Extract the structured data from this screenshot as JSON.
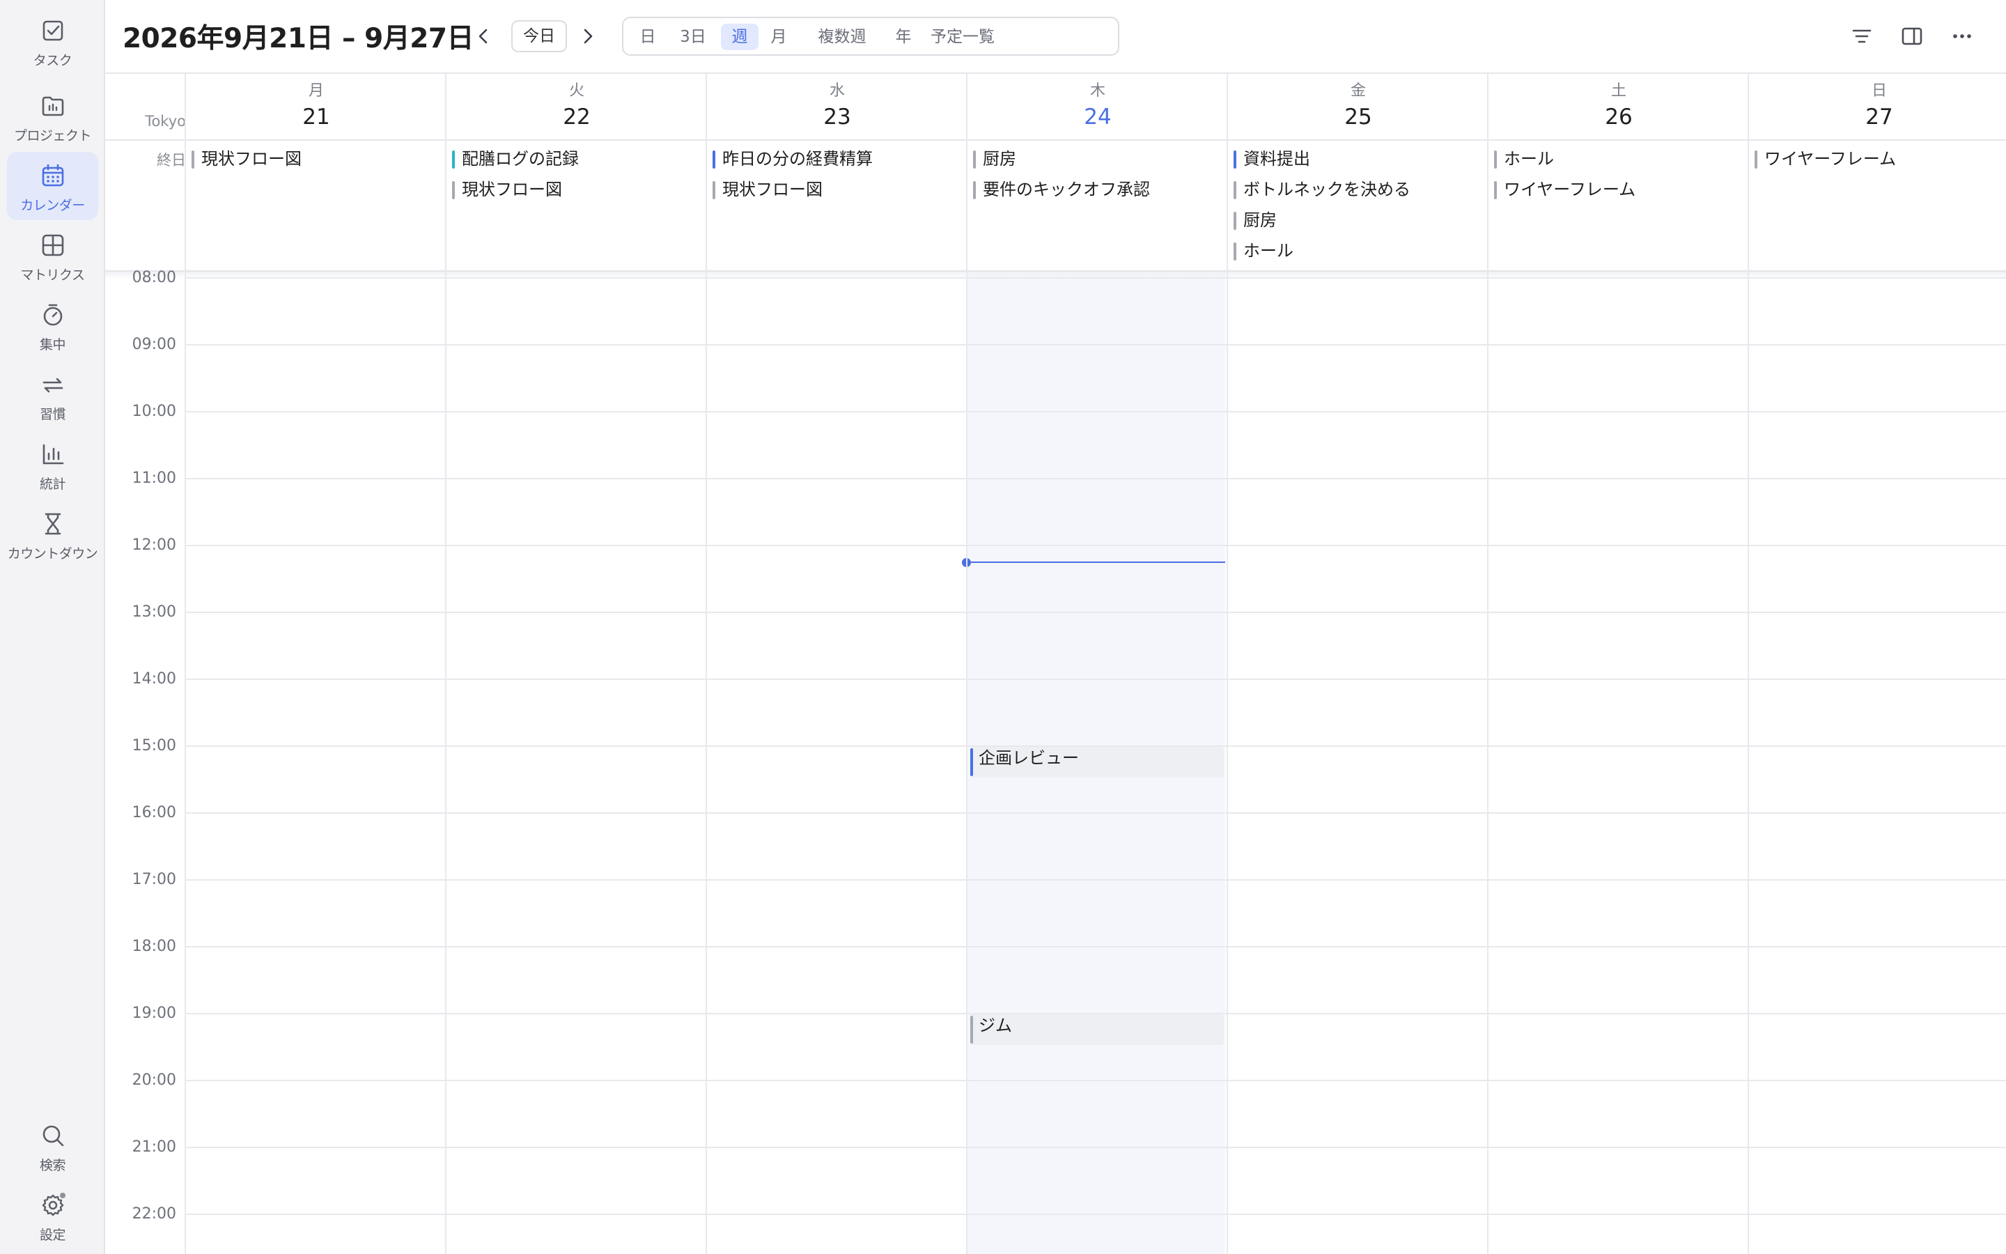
{
  "sidebar": {
    "items": [
      {
        "label": "タスク",
        "icon": "task-check-icon"
      },
      {
        "label": "プロジェクト",
        "icon": "project-folder-icon"
      },
      {
        "label": "カレンダー",
        "icon": "calendar-icon",
        "active": true
      },
      {
        "label": "マトリクス",
        "icon": "matrix-grid-icon"
      },
      {
        "label": "集中",
        "icon": "focus-timer-icon"
      },
      {
        "label": "習慣",
        "icon": "habit-repeat-icon"
      },
      {
        "label": "統計",
        "icon": "statistics-chart-icon"
      },
      {
        "label": "カウントダウン",
        "icon": "countdown-hourglass-icon"
      }
    ],
    "bottom": [
      {
        "label": "検索",
        "icon": "search-icon"
      },
      {
        "label": "設定",
        "icon": "settings-gear-icon"
      }
    ]
  },
  "header": {
    "title": "2026年9月21日 – 9月27日",
    "today_label": "今日",
    "views": [
      "日",
      "3日",
      "週",
      "月",
      "複数週",
      "年",
      "予定一覧"
    ],
    "active_view": "週"
  },
  "calendar": {
    "timezone": "Tokyo",
    "allday_label": "終日",
    "days": [
      {
        "dow": "月",
        "date": "21"
      },
      {
        "dow": "火",
        "date": "22"
      },
      {
        "dow": "水",
        "date": "23"
      },
      {
        "dow": "木",
        "date": "24",
        "today": true
      },
      {
        "dow": "金",
        "date": "25"
      },
      {
        "dow": "土",
        "date": "26"
      },
      {
        "dow": "日",
        "date": "27"
      }
    ],
    "allday_events": [
      [
        {
          "title": "現状フロー図",
          "color": "#a7a9b0"
        }
      ],
      [
        {
          "title": "配膳ログの記録",
          "color": "#2bb3c0"
        },
        {
          "title": "現状フロー図",
          "color": "#a7a9b0"
        }
      ],
      [
        {
          "title": "昨日の分の経費精算",
          "color": "#4b6fe2"
        },
        {
          "title": "現状フロー図",
          "color": "#a7a9b0"
        }
      ],
      [
        {
          "title": "厨房",
          "color": "#a7a9b0"
        },
        {
          "title": "要件のキックオフ承認",
          "color": "#a7a9b0"
        }
      ],
      [
        {
          "title": "資料提出",
          "color": "#4b6fe2"
        },
        {
          "title": "ボトルネックを決める",
          "color": "#a7a9b0"
        },
        {
          "title": "厨房",
          "color": "#a7a9b0"
        },
        {
          "title": "ホール",
          "color": "#a7a9b0"
        }
      ],
      [
        {
          "title": "ホール",
          "color": "#a7a9b0"
        },
        {
          "title": "ワイヤーフレーム",
          "color": "#a7a9b0"
        }
      ],
      [
        {
          "title": "ワイヤーフレーム",
          "color": "#a7a9b0"
        }
      ]
    ],
    "hours": [
      "08:00",
      "09:00",
      "10:00",
      "11:00",
      "12:00",
      "13:00",
      "14:00",
      "15:00",
      "16:00",
      "17:00",
      "18:00",
      "19:00",
      "20:00",
      "21:00",
      "22:00"
    ],
    "timed_events": [
      {
        "day": 3,
        "title": "企画レビュー",
        "start": "15:00",
        "end": "15:30",
        "color": "#4b6fe2"
      },
      {
        "day": 3,
        "title": "ジム",
        "start": "19:00",
        "end": "19:30",
        "color": "#a7a9b0"
      }
    ],
    "current_time": "12:15"
  }
}
